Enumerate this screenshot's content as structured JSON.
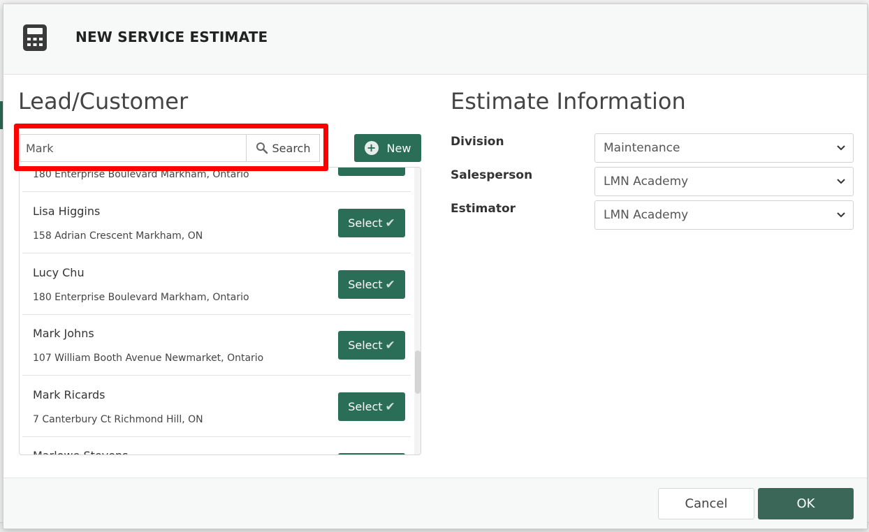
{
  "modal": {
    "title": "NEW SERVICE ESTIMATE",
    "icon": "calculator-icon"
  },
  "lead": {
    "title": "Lead/Customer",
    "search": {
      "value": "Mark",
      "button_label": "Search",
      "icon": "search-icon"
    },
    "new_button_label": "New",
    "select_label": "Select",
    "results": [
      {
        "name": "",
        "address": "180 Enterprise Boulevard Markham, Ontario"
      },
      {
        "name": "Lisa Higgins",
        "address": "158 Adrian Crescent Markham, ON"
      },
      {
        "name": "Lucy Chu",
        "address": "180 Enterprise Boulevard Markham, Ontario"
      },
      {
        "name": "Mark Johns",
        "address": "107 William Booth Avenue Newmarket, Ontario"
      },
      {
        "name": "Mark Ricards",
        "address": "7 Canterbury Ct Richmond Hill, ON"
      },
      {
        "name": "Marlowe Stevens",
        "address": ""
      }
    ]
  },
  "estimate": {
    "title": "Estimate Information",
    "fields": [
      {
        "label": "Division",
        "value": "Maintenance"
      },
      {
        "label": "Salesperson",
        "value": "LMN Academy"
      },
      {
        "label": "Estimator",
        "value": "LMN Academy"
      }
    ]
  },
  "footer": {
    "cancel_label": "Cancel",
    "ok_label": "OK"
  },
  "colors": {
    "brand_green": "#2b6e57",
    "ok_green": "#3b6758",
    "highlight_red": "#ff0000"
  }
}
